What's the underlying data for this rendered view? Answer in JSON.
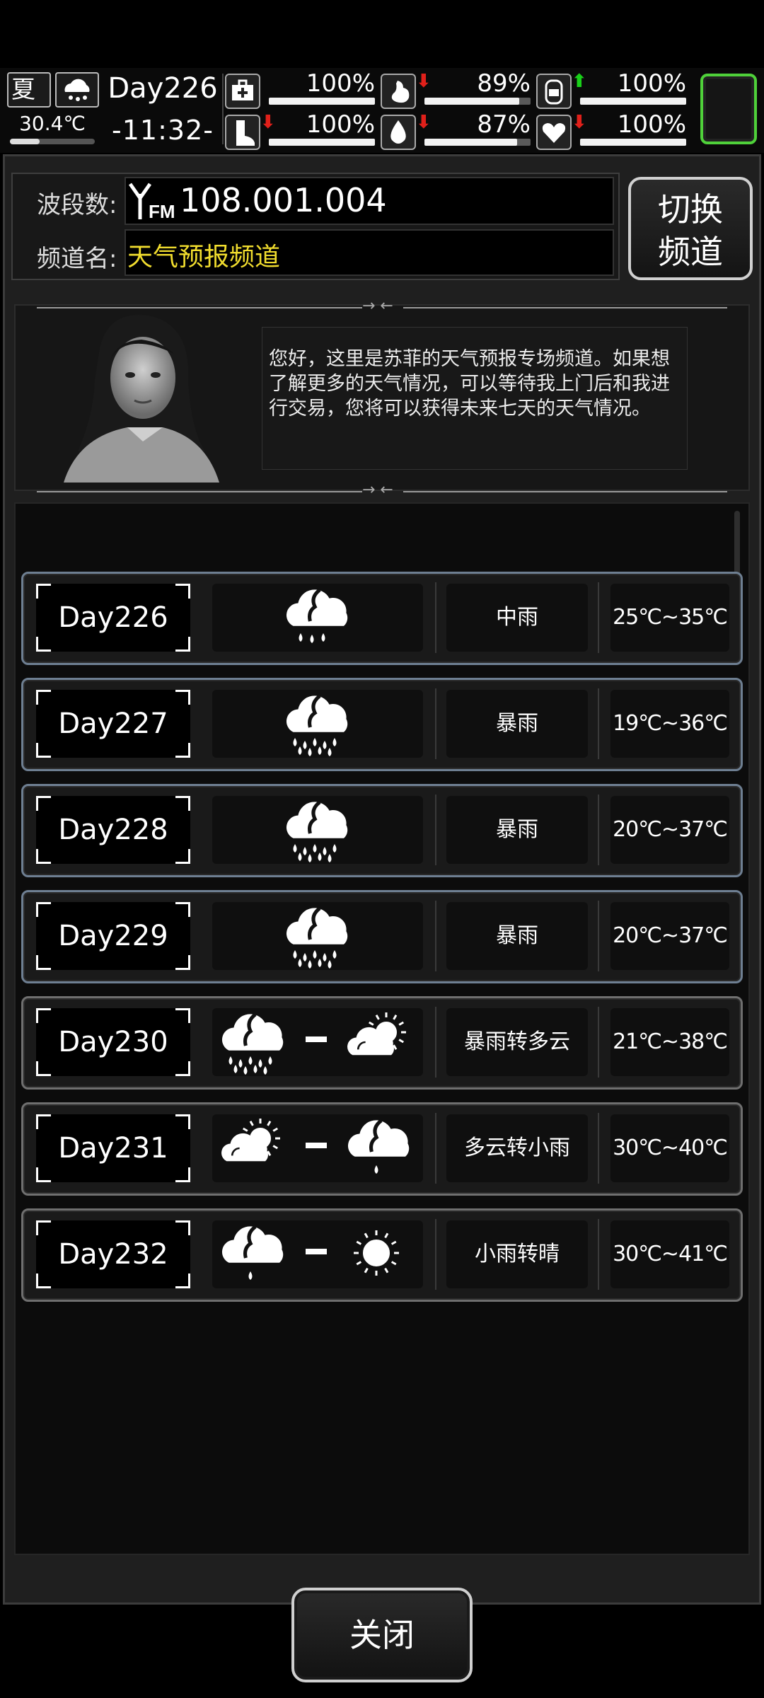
{
  "status": {
    "season": "夏",
    "temperature": "30.4℃",
    "temperature_level": 0.35,
    "day": "Day226",
    "time": "-11:32-",
    "stats": [
      {
        "name": "health",
        "icon": "medkit-icon",
        "value": "100%",
        "level": 1.0,
        "trend": ""
      },
      {
        "name": "hunger",
        "icon": "stomach-icon",
        "value": "89%",
        "level": 0.89,
        "trend": "down"
      },
      {
        "name": "energy",
        "icon": "energy-icon",
        "value": "100%",
        "level": 1.0,
        "trend": "up"
      },
      {
        "name": "stamina",
        "icon": "boot-icon",
        "value": "100%",
        "level": 1.0,
        "trend": "down"
      },
      {
        "name": "thirst",
        "icon": "water-drop-icon",
        "value": "87%",
        "level": 0.87,
        "trend": "down"
      },
      {
        "name": "mood",
        "icon": "heart-icon",
        "value": "100%",
        "level": 1.0,
        "trend": "down"
      }
    ]
  },
  "channel": {
    "band_label": "波段数:",
    "band_value": "108.001.004",
    "fm_label": "FM",
    "name_label": "频道名:",
    "name_value": "天气预报频道",
    "switch_label_line1": "切换",
    "switch_label_line2": "频道"
  },
  "announcer": {
    "message": "您好，这里是苏菲的天气预报专场频道。如果想了解更多的天气情况，可以等待我上门后和我进行交易，您将可以获得未来七天的天气情况。"
  },
  "forecast": [
    {
      "day": "Day226",
      "condition": "中雨",
      "temp": "25℃~35℃",
      "icons": [
        "rain-medium-icon"
      ]
    },
    {
      "day": "Day227",
      "condition": "暴雨",
      "temp": "19℃~36℃",
      "icons": [
        "rainstorm-icon"
      ]
    },
    {
      "day": "Day228",
      "condition": "暴雨",
      "temp": "20℃~37℃",
      "icons": [
        "rainstorm-icon"
      ]
    },
    {
      "day": "Day229",
      "condition": "暴雨",
      "temp": "20℃~37℃",
      "icons": [
        "rainstorm-icon"
      ]
    },
    {
      "day": "Day230",
      "condition": "暴雨转多云",
      "temp": "21℃~38℃",
      "icons": [
        "rainstorm-icon",
        "partly-cloudy-icon"
      ]
    },
    {
      "day": "Day231",
      "condition": "多云转小雨",
      "temp": "30℃~40℃",
      "icons": [
        "partly-cloudy-icon",
        "rain-light-icon"
      ]
    },
    {
      "day": "Day232",
      "condition": "小雨转晴",
      "temp": "30℃~41℃",
      "icons": [
        "rain-light-icon",
        "sunny-icon"
      ]
    }
  ],
  "close_label": "关闭",
  "colors": {
    "accent_green": "#4fd13a",
    "channel_name": "#f1dd2e",
    "trend_down": "#e0201a",
    "trend_up": "#19d019"
  }
}
